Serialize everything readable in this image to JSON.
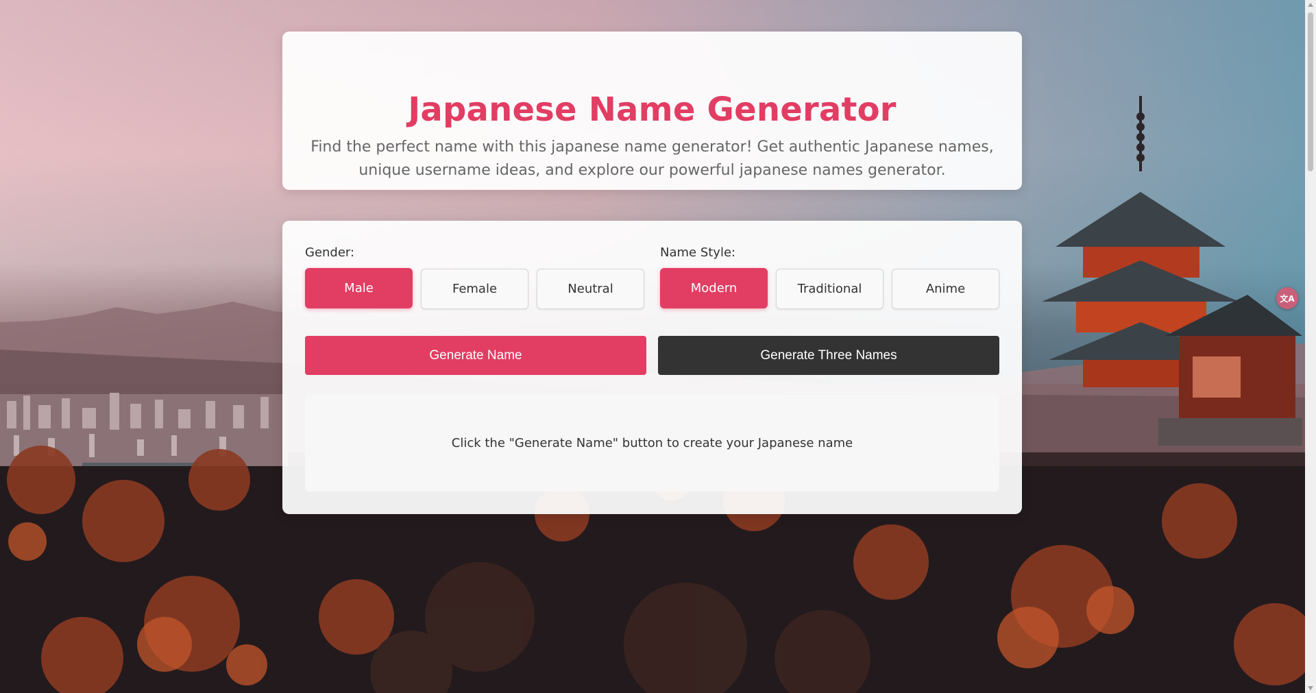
{
  "header": {
    "title": "Japanese Name Generator",
    "description": "Find the perfect name with this japanese name generator! Get authentic Japanese names, unique username ideas, and explore our powerful japanese names generator."
  },
  "gender": {
    "label": "Gender:",
    "options": [
      "Male",
      "Female",
      "Neutral"
    ],
    "selected": "Male"
  },
  "style": {
    "label": "Name Style:",
    "options": [
      "Modern",
      "Traditional",
      "Anime"
    ],
    "selected": "Modern"
  },
  "actions": {
    "generate_one": "Generate Name",
    "generate_three": "Generate Three Names"
  },
  "result": {
    "placeholder": "Click the \"Generate Name\" button to create your Japanese name"
  },
  "extension": {
    "icon": "translate-icon",
    "glyph": "文A"
  },
  "colors": {
    "accent": "#e23d63",
    "dark_button": "#333333"
  }
}
